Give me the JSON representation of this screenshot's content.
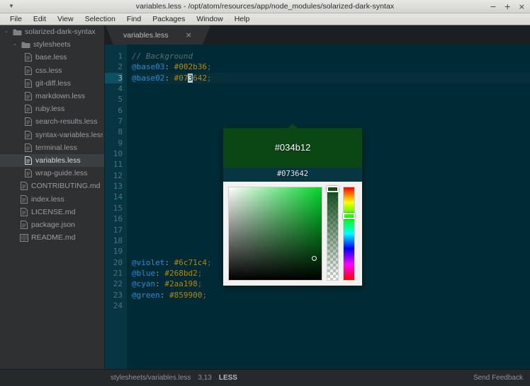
{
  "window": {
    "title": "variables.less - /opt/atom/resources/app/node_modules/solarized-dark-syntax",
    "menu_glyph": "▼",
    "minimize": "−",
    "maximize": "+",
    "close": "×"
  },
  "menubar": {
    "items": [
      "File",
      "Edit",
      "View",
      "Selection",
      "Find",
      "Packages",
      "Window",
      "Help"
    ]
  },
  "sidebar": {
    "root": {
      "label": "solarized-dark-syntax",
      "twisty": "⌄",
      "icon": "folder-icon"
    },
    "stylesheets": {
      "label": "stylesheets",
      "twisty": "⌄",
      "icon": "folder-icon"
    },
    "stylesheet_files": [
      {
        "label": "base.less",
        "icon": "file-icon"
      },
      {
        "label": "css.less",
        "icon": "file-icon"
      },
      {
        "label": "git-diff.less",
        "icon": "file-icon"
      },
      {
        "label": "markdown.less",
        "icon": "file-icon"
      },
      {
        "label": "ruby.less",
        "icon": "file-icon"
      },
      {
        "label": "search-results.less",
        "icon": "file-icon"
      },
      {
        "label": "syntax-variables.less",
        "icon": "file-icon"
      },
      {
        "label": "terminal.less",
        "icon": "file-icon"
      },
      {
        "label": "variables.less",
        "icon": "file-icon",
        "selected": true
      },
      {
        "label": "wrap-guide.less",
        "icon": "file-icon"
      }
    ],
    "root_files": [
      {
        "label": "CONTRIBUTING.md",
        "icon": "file-icon"
      },
      {
        "label": "index.less",
        "icon": "file-icon"
      },
      {
        "label": "LICENSE.md",
        "icon": "file-icon"
      },
      {
        "label": "package.json",
        "icon": "file-icon"
      },
      {
        "label": "README.md",
        "icon": "book-icon"
      }
    ]
  },
  "tab": {
    "title": "variables.less",
    "close": "×"
  },
  "editor": {
    "line_numbers": [
      "1",
      "2",
      "3",
      "4",
      "5",
      "6",
      "7",
      "8",
      "9",
      "10",
      "11",
      "12",
      "13",
      "14",
      "15",
      "16",
      "17",
      "18",
      "19",
      "20",
      "21",
      "22",
      "23",
      "24"
    ],
    "active_line": 3,
    "lines": [
      {
        "n": 1,
        "type": "comment",
        "text": "// Background"
      },
      {
        "n": 2,
        "type": "decl",
        "var": "@base03",
        "colon": ":",
        "hex": "#002b36",
        "semi": ";"
      },
      {
        "n": 3,
        "type": "decl-cursor",
        "var": "@base02",
        "colon": ":",
        "hex_pre": "#07",
        "hex_cursor": "3",
        "hex_post": "642",
        "semi": ";"
      },
      {
        "n": 20,
        "type": "decl",
        "var": "@violet",
        "colon": ":",
        "hex": "#6c71c4",
        "semi": ";"
      },
      {
        "n": 21,
        "type": "decl",
        "var": "@blue",
        "colon": ":",
        "hex": "#268bd2",
        "semi": ";"
      },
      {
        "n": 22,
        "type": "decl",
        "var": "@cyan",
        "colon": ":",
        "hex": "#2aa198",
        "semi": ";"
      },
      {
        "n": 23,
        "type": "decl",
        "var": "@green",
        "colon": ":",
        "hex": "#859900",
        "semi": ";"
      }
    ]
  },
  "colorpicker": {
    "preview_hex": "#034b12",
    "original_hex": "#073642",
    "preview_swatch_color": "#0b4715",
    "original_swatch_color": "#073642",
    "hue_base_color": "#00d72a"
  },
  "statusbar": {
    "path": "stylesheets/variables.less",
    "cursor_position": "3,13",
    "grammar": "LESS",
    "feedback": "Send Feedback"
  }
}
